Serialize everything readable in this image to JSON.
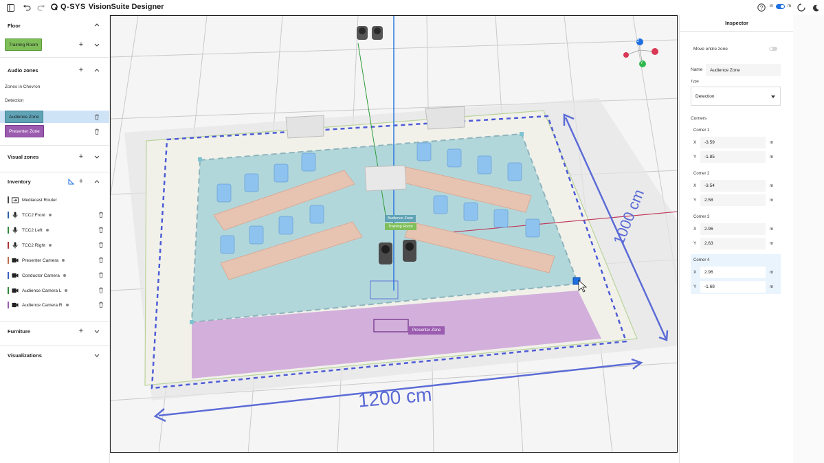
{
  "app": {
    "logo": "Q-SYS",
    "title": "VisionSuite Designer",
    "unit_left": "in",
    "unit_right": "m"
  },
  "left": {
    "floor": {
      "title": "Floor",
      "room": "Training Room",
      "room_color": "#7fbf5a"
    },
    "audio_zones": {
      "title": "Audio zones",
      "group_label": "Zones in Chevron",
      "type_label": "Detection",
      "zones": [
        {
          "label": "Audience Zone",
          "color": "#5fa3b5"
        },
        {
          "label": "Presenter Zone",
          "color": "#9b5cb0"
        }
      ]
    },
    "visual_zones": {
      "title": "Visual zones"
    },
    "inventory": {
      "title": "Inventory",
      "items": [
        {
          "label": "Mediacast Router",
          "icon": "router-icon",
          "color": "#444444"
        },
        {
          "label": "TCC2 Front",
          "icon": "mic-icon",
          "color": "#2b5fab"
        },
        {
          "label": "TCC2 Left",
          "icon": "mic-icon",
          "color": "#2f8a3a"
        },
        {
          "label": "TCC2 Right",
          "icon": "mic-icon",
          "color": "#b03232"
        },
        {
          "label": "Presenter Camera",
          "icon": "camera-icon",
          "color": "#c06a4c"
        },
        {
          "label": "Conductor Camera",
          "icon": "camera-icon",
          "color": "#3a5fc0"
        },
        {
          "label": "Audience Camera L",
          "icon": "camera-icon",
          "color": "#2f8a3a"
        },
        {
          "label": "Audience Camera R",
          "icon": "camera-icon",
          "color": "#9b5cb0"
        }
      ]
    },
    "furniture": {
      "title": "Furniture"
    },
    "visualizations": {
      "title": "Visualizations"
    }
  },
  "viewport": {
    "label_width": "1200 cm",
    "label_depth": "1000 cm",
    "tag_audience": "Audience Zone",
    "tag_training": "Training Room",
    "tag_presenter": "Presenter Zone",
    "axis_z": "Z",
    "axis_y": "Y",
    "colors": {
      "audience": "#7fc3d0",
      "presenter": "#c79ad6",
      "dimension": "#5b6bd6"
    }
  },
  "inspector": {
    "title": "Inspector",
    "move_label": "Move entire zone",
    "name_label": "Name",
    "name_value": "Audience Zone",
    "type_label": "Type",
    "type_value": "Detection",
    "corners_label": "Corners",
    "unit": "m",
    "corners": [
      {
        "label": "Corner 1",
        "x": "-3.59",
        "y": "-1.85"
      },
      {
        "label": "Corner 2",
        "x": "-3.54",
        "y": "2.58"
      },
      {
        "label": "Corner 3",
        "x": "2.96",
        "y": "2.63"
      },
      {
        "label": "Corner 4",
        "x": "2.96",
        "y": "-1.68"
      }
    ]
  }
}
